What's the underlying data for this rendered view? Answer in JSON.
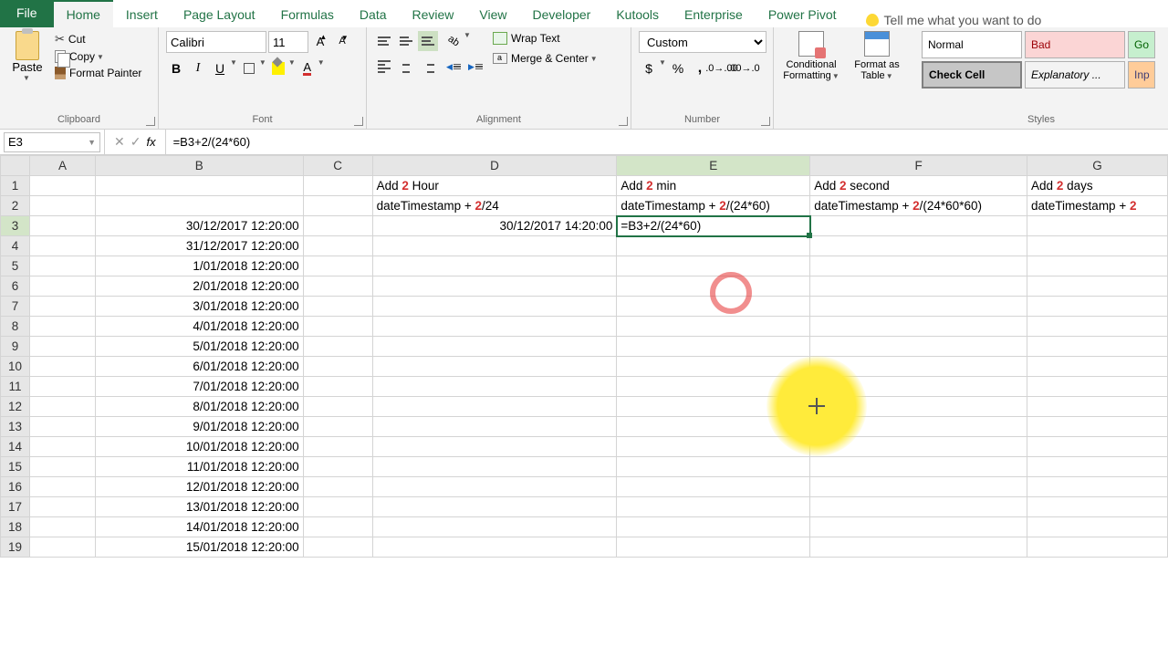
{
  "tabs": {
    "file": "File",
    "home": "Home",
    "insert": "Insert",
    "pageLayout": "Page Layout",
    "formulas": "Formulas",
    "data": "Data",
    "review": "Review",
    "view": "View",
    "developer": "Developer",
    "kutools": "Kutools",
    "enterprise": "Enterprise",
    "powerPivot": "Power Pivot",
    "tellMe": "Tell me what you want to do"
  },
  "ribbon": {
    "clipboard": {
      "paste": "Paste",
      "cut": "Cut",
      "copy": "Copy",
      "formatPainter": "Format Painter",
      "label": "Clipboard"
    },
    "font": {
      "name": "Calibri",
      "size": "11",
      "label": "Font"
    },
    "alignment": {
      "wrap": "Wrap Text",
      "merge": "Merge & Center",
      "label": "Alignment"
    },
    "number": {
      "format": "Custom",
      "label": "Number"
    },
    "cond": {
      "label1": "Conditional",
      "label2": "Formatting"
    },
    "fmtTable": {
      "label1": "Format as",
      "label2": "Table"
    },
    "styles": {
      "normal": "Normal",
      "bad": "Bad",
      "check": "Check Cell",
      "explanatory": "Explanatory ...",
      "good": "Go",
      "input": "Inp",
      "label": "Styles"
    }
  },
  "formulaBar": {
    "nameBox": "E3",
    "formula": "=B3+2/(24*60)"
  },
  "cols": [
    "A",
    "B",
    "C",
    "D",
    "E",
    "F",
    "G"
  ],
  "rows": [
    "1",
    "2",
    "3",
    "4",
    "5",
    "6",
    "7",
    "8",
    "9",
    "10",
    "11",
    "12",
    "13",
    "14",
    "15",
    "16",
    "17",
    "18",
    "19"
  ],
  "headers": {
    "D1": {
      "pre": "Add ",
      "n": "2",
      "post": "  Hour"
    },
    "E1": {
      "pre": "Add ",
      "n": "2",
      "post": "  min"
    },
    "F1": {
      "pre": "Add ",
      "n": "2",
      "post": "  second"
    },
    "G1": {
      "pre": "Add ",
      "n": "2",
      "post": "  days"
    },
    "D2": {
      "pre": "dateTimestamp + ",
      "n": "2",
      "post": "/24"
    },
    "E2": {
      "pre": "dateTimestamp + ",
      "n": "2",
      "post": "/(24*60)"
    },
    "F2": {
      "pre": "dateTimestamp + ",
      "n": "2",
      "post": "/(24*60*60)"
    },
    "G2": {
      "pre": "dateTimestamp + ",
      "n": "2",
      "post": ""
    }
  },
  "colB": [
    "30/12/2017 12:20:00",
    "31/12/2017 12:20:00",
    "1/01/2018 12:20:00",
    "2/01/2018 12:20:00",
    "3/01/2018 12:20:00",
    "4/01/2018 12:20:00",
    "5/01/2018 12:20:00",
    "6/01/2018 12:20:00",
    "7/01/2018 12:20:00",
    "8/01/2018 12:20:00",
    "9/01/2018 12:20:00",
    "10/01/2018 12:20:00",
    "11/01/2018 12:20:00",
    "12/01/2018 12:20:00",
    "13/01/2018 12:20:00",
    "14/01/2018 12:20:00",
    "15/01/2018 12:20:00"
  ],
  "D3": "30/12/2017 14:20:00",
  "E3": "=B3+2/(24*60)"
}
